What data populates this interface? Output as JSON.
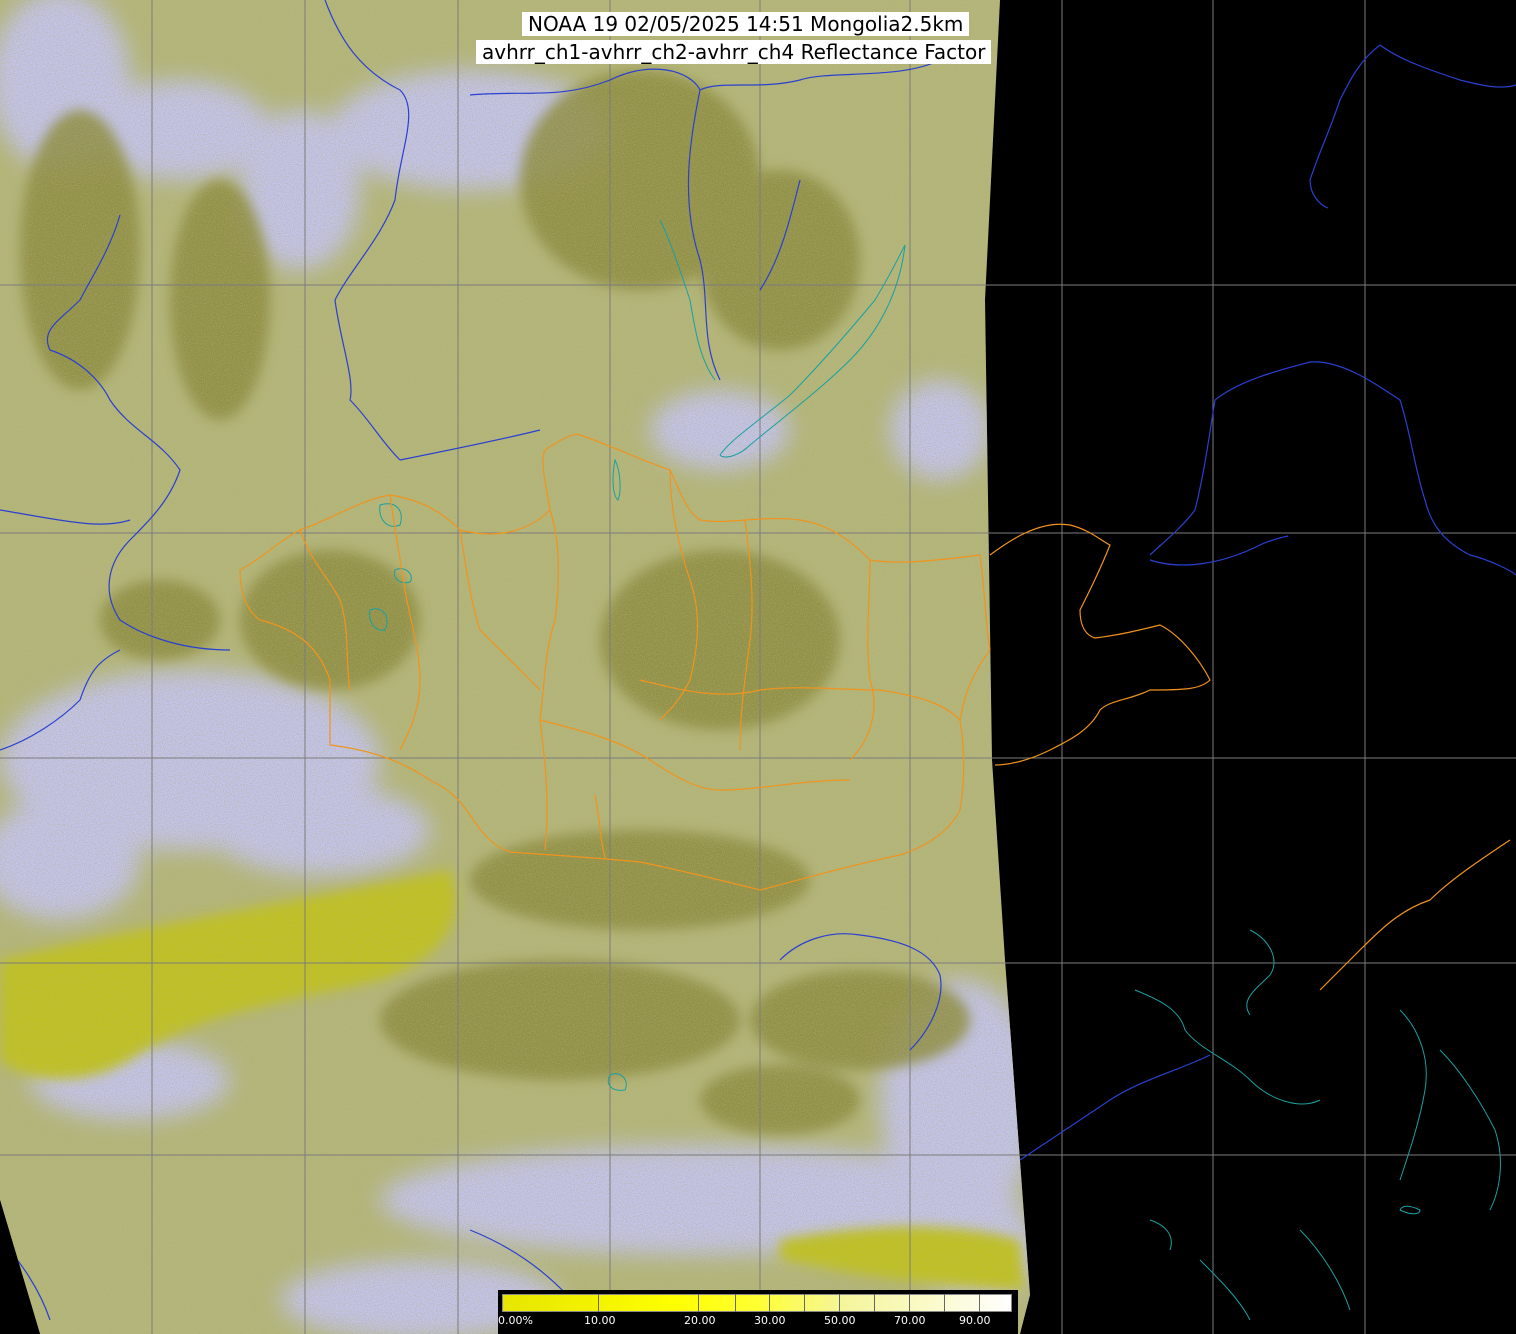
{
  "title": {
    "line1": "NOAA 19 02/05/2025 14:51 Mongolia2.5km",
    "line2": "avhrr_ch1-avhrr_ch2-avhrr_ch4 Reflectance Factor"
  },
  "colorbar": {
    "labels": [
      "0.00%",
      "10.00",
      "20.00",
      "30.00",
      "50.00",
      "70.00",
      "90.00"
    ],
    "colors": [
      "#e6e600",
      "#f2f200",
      "#ffff00",
      "#ffff33",
      "#f5f59a",
      "#fafac8",
      "#ffffff"
    ]
  },
  "colors": {
    "background": "#000000",
    "land_base": "#b4b67a",
    "terrain_dark": "#7d7c32",
    "cloud": "#c4c4f0",
    "yellow_haze": "#c2c21c",
    "border_orange": "#f0941e",
    "river_blue": "#2a40d0",
    "coast_teal": "#1aa0a0",
    "grid": "#7c7c7c"
  },
  "icons": {
    "legend": "colorbar-gradient"
  }
}
